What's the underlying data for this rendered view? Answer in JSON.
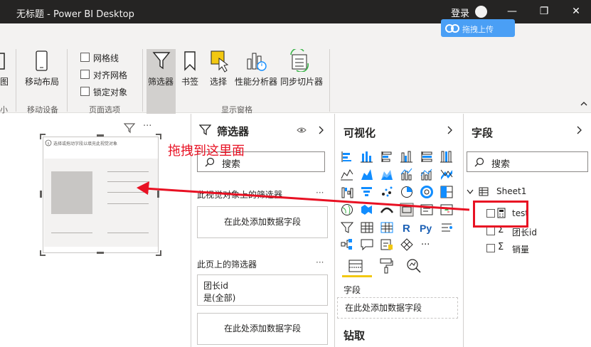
{
  "titlebar": {
    "title": "无标题 - Power BI Desktop",
    "login": "登录",
    "minimize": "—",
    "restore": "❐",
    "close": "✕"
  },
  "cloud_badge": {
    "text": "拖拽上传"
  },
  "ribbon": {
    "partial_item": "图",
    "partial_group": "小",
    "mobile_layout": "移动布局",
    "mobile_group": "移动设备",
    "checkboxes": [
      "网格线",
      "对齐网格",
      "锁定对象"
    ],
    "page_options_group": "页面选项",
    "pane_buttons": [
      "筛选器",
      "书签",
      "选择",
      "性能分析器",
      "同步切片器"
    ],
    "show_panes_group": "显示窗格"
  },
  "canvas": {
    "visual_hint": "选择或拖动字段以填充此视觉对象"
  },
  "annotation": {
    "text": "拖拽到这里面"
  },
  "filters": {
    "title": "筛选器",
    "search_placeholder": "搜索",
    "visual_section": "此视觉对象上的筛选器",
    "add_field": "在此处添加数据字段",
    "page_section": "此页上的筛选器",
    "page_filter_name": "团长id",
    "page_filter_value": "是(全部)",
    "add_field_2": "在此处添加数据字段",
    "more": "···"
  },
  "visualizations": {
    "title": "可视化",
    "tab_fields": "字段",
    "add_field": "在此处添加数据字段",
    "drill": "钻取",
    "more": "···"
  },
  "fields": {
    "title": "字段",
    "search_placeholder": "搜索",
    "table_name": "Sheet1",
    "items": [
      {
        "name": "test",
        "icon": "calculator-icon"
      },
      {
        "name": "团长id",
        "icon": "sigma-icon"
      },
      {
        "name": "销量",
        "icon": "sigma-icon"
      }
    ]
  },
  "colors": {
    "titlebar": "#252423",
    "ribbon": "#f3f2f1",
    "accent_yellow": "#f2c811",
    "annotation_red": "#e81123",
    "cloud_blue": "#4a9ff5"
  }
}
